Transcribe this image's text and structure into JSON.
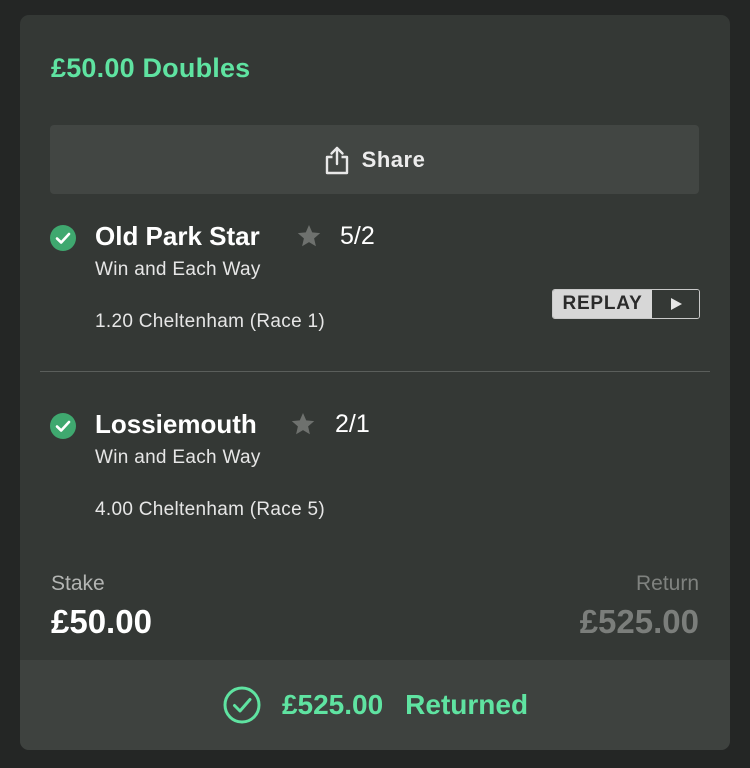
{
  "bet": {
    "title": "£50.00 Doubles",
    "share_label": "Share"
  },
  "selections": [
    {
      "horse": "Old Park Star",
      "odds": "5/2",
      "market": "Win and Each Way",
      "race": "1.20 Cheltenham (Race 1)",
      "replay_label": "REPLAY"
    },
    {
      "horse": "Lossiemouth",
      "odds": "2/1",
      "market": "Win and Each Way",
      "race": "4.00 Cheltenham (Race 5)"
    }
  ],
  "summary": {
    "stake_label": "Stake",
    "stake_value": "£50.00",
    "return_label": "Return",
    "return_value": "£525.00"
  },
  "footer": {
    "amount": "£525.00",
    "status": "Returned"
  },
  "colors": {
    "accent": "#5fe3a1",
    "check": "#3fa86f",
    "card": "#343835",
    "background": "#242625"
  },
  "icons": {
    "share": "share-icon",
    "check": "check-circle-icon",
    "star": "star-icon",
    "play": "play-icon",
    "returned": "check-circle-outline-icon"
  }
}
